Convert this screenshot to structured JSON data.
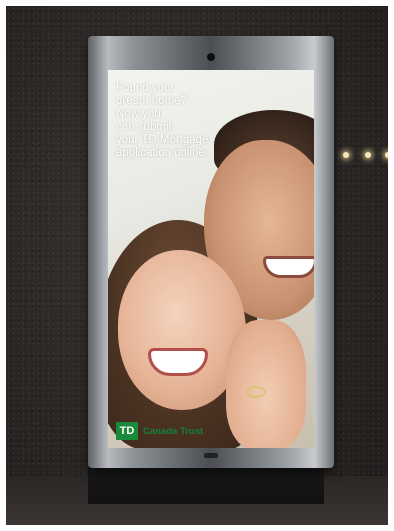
{
  "ad": {
    "headline_lines": [
      "Found your",
      "dream home?",
      "Now you",
      "can submit",
      "your TD Mortgage",
      "application online."
    ],
    "logo_mark": "TD",
    "brand_name": "Canada Trust"
  },
  "colors": {
    "brand_green": "#1a8a3a",
    "frame_steel": "#8e9397",
    "wall_dark": "#2a2624"
  },
  "icons": [
    "td-logo-icon",
    "camera-icon"
  ]
}
